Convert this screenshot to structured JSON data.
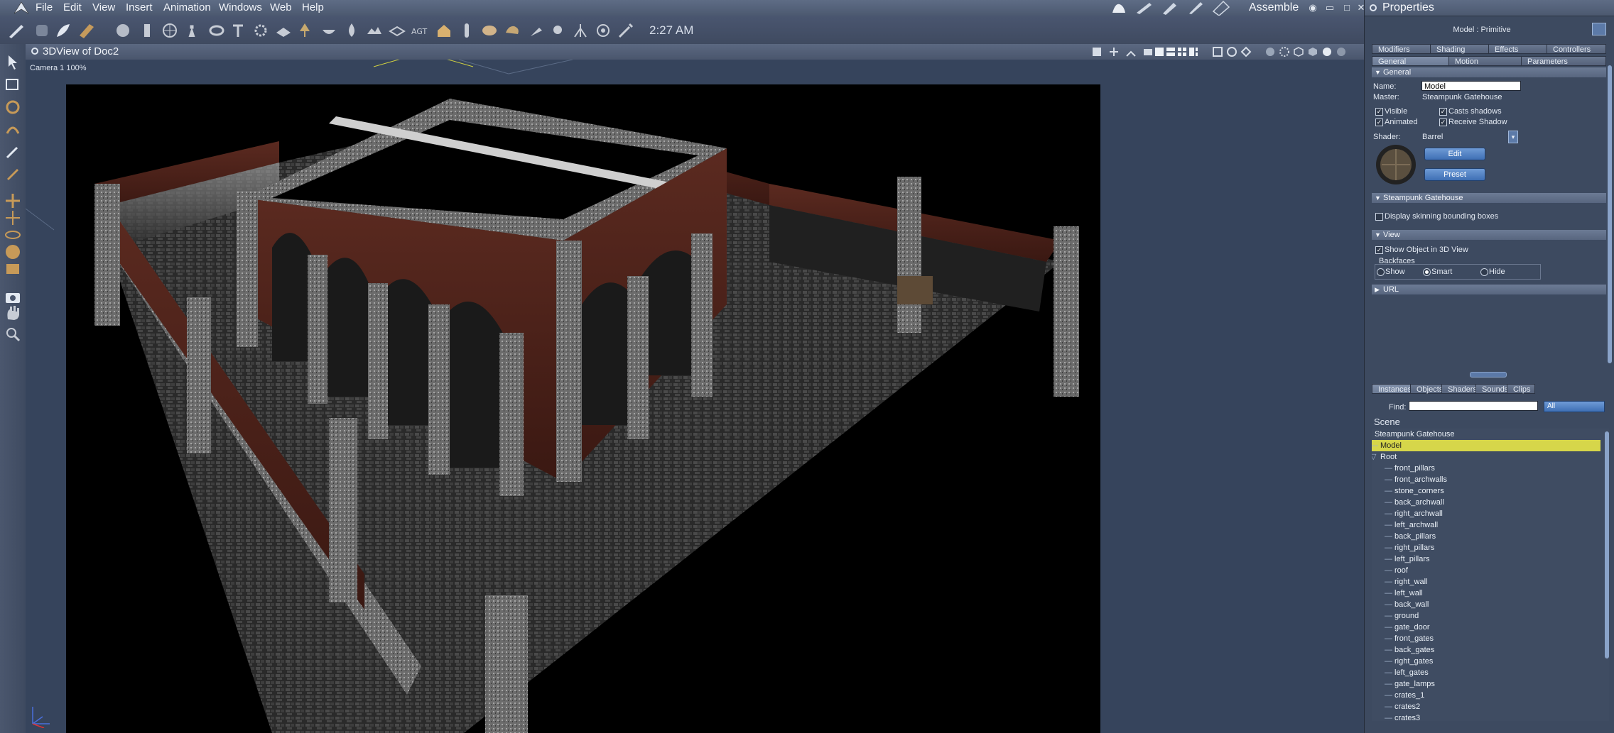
{
  "menubar": {
    "items": [
      "File",
      "Edit",
      "View",
      "Insert",
      "Animation",
      "Windows",
      "Web",
      "Help"
    ],
    "room": "Assemble"
  },
  "toolbar": {
    "clock": "2:27 AM"
  },
  "viewport": {
    "title": "3DView of Doc2",
    "camera_label": "Camera 1 100%"
  },
  "properties": {
    "title": "Properties",
    "model_label": "Model : Primitive",
    "tabs_row1": [
      "Modifiers",
      "Shading",
      "Effects",
      "Controllers"
    ],
    "tabs_row2": [
      "General",
      "Motion",
      "Parameters"
    ],
    "general": {
      "header": "General",
      "name_label": "Name:",
      "name_value": "Model",
      "master_label": "Master:",
      "master_value": "Steampunk Gatehouse",
      "visible": "Visible",
      "casts_shadows": "Casts shadows",
      "animated": "Animated",
      "receive_shadow": "Receive Shadow",
      "shader_label": "Shader:",
      "shader_value": "Barrel",
      "edit_button": "Edit",
      "preset_button": "Preset"
    },
    "gatehouse": {
      "header": "Steampunk Gatehouse",
      "display_skinning": "Display skinning bounding boxes"
    },
    "view": {
      "header": "View",
      "show_object": "Show Object in 3D View",
      "backfaces": "Backfaces",
      "show": "Show",
      "smart": "Smart",
      "hide": "Hide"
    },
    "url": {
      "header": "URL"
    }
  },
  "browser": {
    "tabs": [
      "Instances",
      "Objects",
      "Shaders",
      "Sounds",
      "Clips"
    ],
    "find_label": "Find:",
    "find_value": "",
    "filter_value": "All",
    "scene_label": "Scene",
    "tree": [
      {
        "label": "Steampunk Gatehouse",
        "indent": 0
      },
      {
        "label": "Model",
        "indent": 1,
        "selected": true
      },
      {
        "label": "Root",
        "indent": 1
      },
      {
        "label": "front_pillars",
        "indent": 2
      },
      {
        "label": "front_archwalls",
        "indent": 2
      },
      {
        "label": "stone_corners",
        "indent": 2
      },
      {
        "label": "back_archwall",
        "indent": 2
      },
      {
        "label": "right_archwall",
        "indent": 2
      },
      {
        "label": "left_archwall",
        "indent": 2
      },
      {
        "label": "back_pillars",
        "indent": 2
      },
      {
        "label": "right_pillars",
        "indent": 2
      },
      {
        "label": "left_pillars",
        "indent": 2
      },
      {
        "label": "roof",
        "indent": 2
      },
      {
        "label": "right_wall",
        "indent": 2
      },
      {
        "label": "left_wall",
        "indent": 2
      },
      {
        "label": "back_wall",
        "indent": 2
      },
      {
        "label": "ground",
        "indent": 2
      },
      {
        "label": "gate_door",
        "indent": 2
      },
      {
        "label": "front_gates",
        "indent": 2
      },
      {
        "label": "back_gates",
        "indent": 2
      },
      {
        "label": "right_gates",
        "indent": 2
      },
      {
        "label": "left_gates",
        "indent": 2
      },
      {
        "label": "gate_lamps",
        "indent": 2
      },
      {
        "label": "crates_1",
        "indent": 2
      },
      {
        "label": "crates2",
        "indent": 2
      },
      {
        "label": "crates3",
        "indent": 2
      }
    ]
  },
  "colors": {
    "selection": "#d6d64a",
    "button_blue": "#3e6fb4",
    "panel": "#3d4a60"
  }
}
